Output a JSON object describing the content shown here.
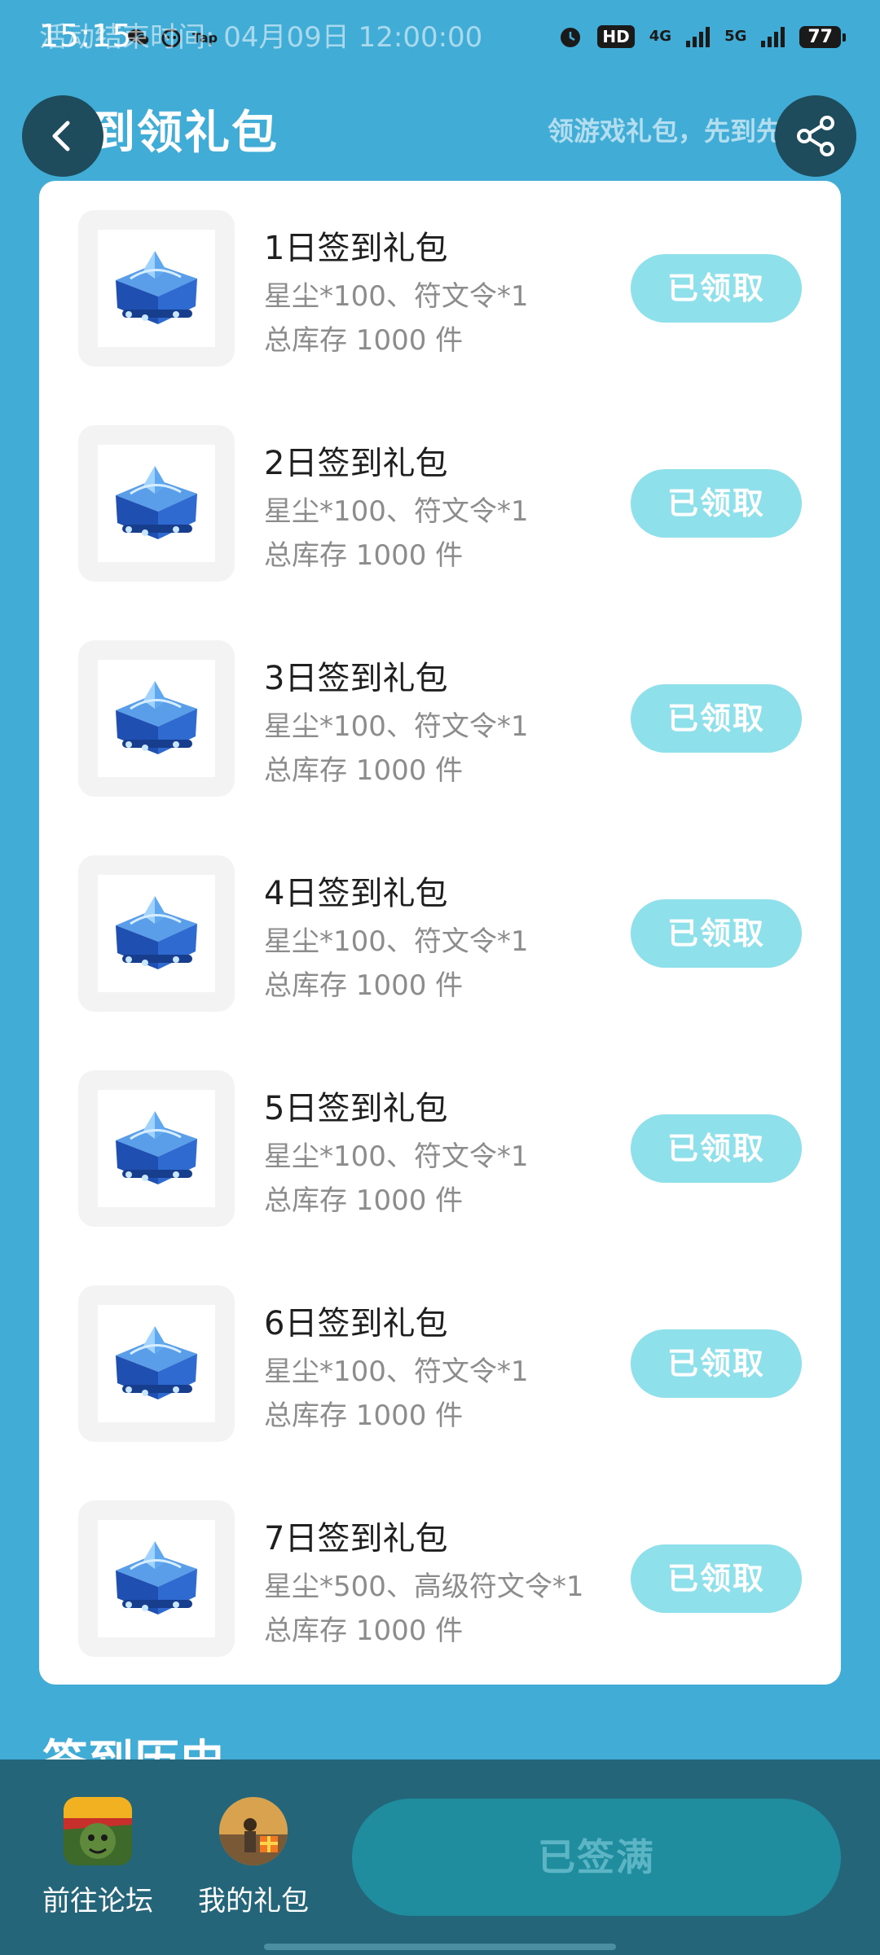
{
  "status_bar": {
    "time": "15:15",
    "overlay_text": "活动结束时间: 04月09日 12:00:00",
    "tap_label": "Tap",
    "hd_label": "HD",
    "network_4g": "4G",
    "network_5g": "5G",
    "battery": "77"
  },
  "header": {
    "title": "签到领礼包",
    "subtitle": "领游戏礼包，先到先得"
  },
  "gifts": [
    {
      "name": "1日签到礼包",
      "desc": "星尘*100、符文令*1",
      "stock": "总库存 1000 件",
      "button": "已领取"
    },
    {
      "name": "2日签到礼包",
      "desc": "星尘*100、符文令*1",
      "stock": "总库存 1000 件",
      "button": "已领取"
    },
    {
      "name": "3日签到礼包",
      "desc": "星尘*100、符文令*1",
      "stock": "总库存 1000 件",
      "button": "已领取"
    },
    {
      "name": "4日签到礼包",
      "desc": "星尘*100、符文令*1",
      "stock": "总库存 1000 件",
      "button": "已领取"
    },
    {
      "name": "5日签到礼包",
      "desc": "星尘*100、符文令*1",
      "stock": "总库存 1000 件",
      "button": "已领取"
    },
    {
      "name": "6日签到礼包",
      "desc": "星尘*100、符文令*1",
      "stock": "总库存 1000 件",
      "button": "已领取"
    },
    {
      "name": "7日签到礼包",
      "desc": "星尘*500、高级符文令*1",
      "stock": "总库存 1000 件",
      "button": "已领取"
    }
  ],
  "section": {
    "title": "签到历史"
  },
  "bottom_bar": {
    "forum_label": "前往论坛",
    "gifts_label": "我的礼包",
    "action_label": "已签满"
  },
  "colors": {
    "background": "#41acd6",
    "claimed_button": "#8ee0ea",
    "bottom_bar": "#24657a",
    "action_button": "#1f8d9e"
  }
}
